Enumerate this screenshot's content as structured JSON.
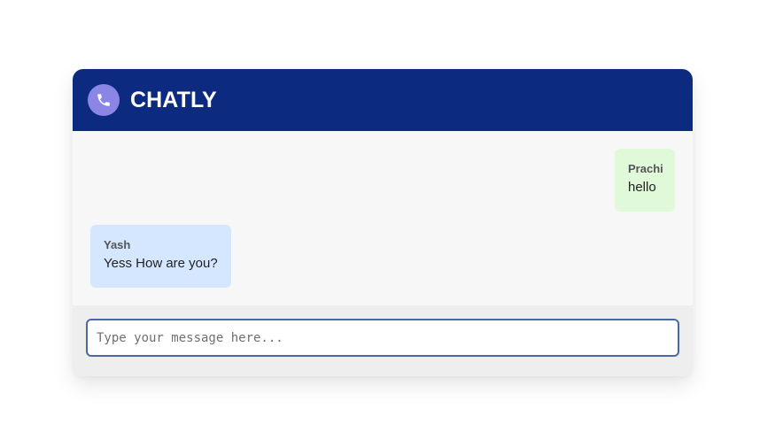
{
  "header": {
    "title": "CHATLY",
    "icon": "phone-icon",
    "colors": {
      "header_bg": "#0b2a80",
      "icon_bg": "#8b86e6",
      "title": "#ffffff"
    }
  },
  "messages": [
    {
      "sender": "Prachi",
      "text": "hello",
      "type": "sent",
      "bubble_color": "#e0f9d9"
    },
    {
      "sender": "Yash",
      "text": "Yess How are you?",
      "type": "received",
      "bubble_color": "#d5e7ff"
    }
  ],
  "composer": {
    "placeholder": "Type your message here...",
    "value": "",
    "border_color": "#4b67a5"
  }
}
